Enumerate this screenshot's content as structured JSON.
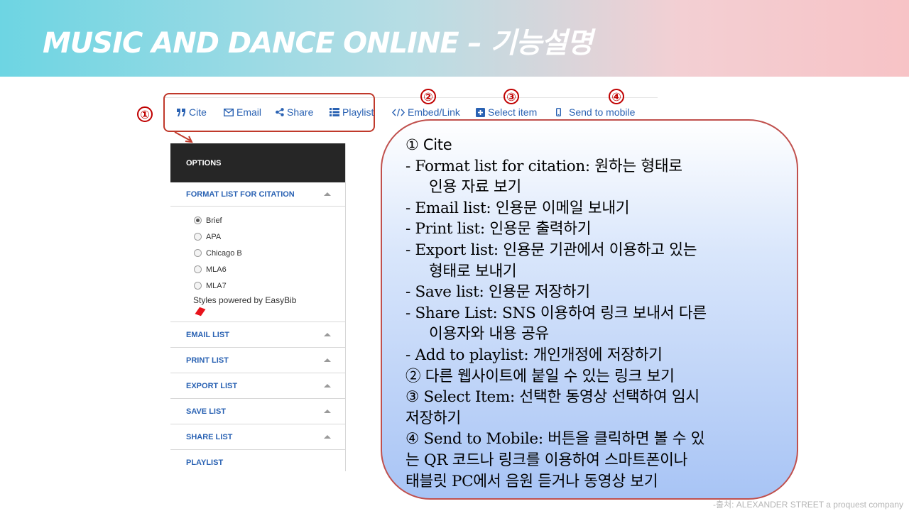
{
  "header": {
    "title": "MUSIC AND DANCE ONLINE – 기능설명"
  },
  "toolbar": {
    "items": [
      {
        "label": "Cite",
        "icon": "quote-icon"
      },
      {
        "label": "Email",
        "icon": "envelope-icon"
      },
      {
        "label": "Share",
        "icon": "share-icon"
      },
      {
        "label": "Playlist",
        "icon": "list-icon"
      },
      {
        "label": "Embed/Link",
        "icon": "code-icon"
      },
      {
        "label": "Select item",
        "icon": "plus-box-icon"
      },
      {
        "label": "Send to mobile",
        "icon": "mobile-icon"
      }
    ]
  },
  "markers": [
    "①",
    "②",
    "③",
    "④"
  ],
  "options": {
    "header": "OPTIONS",
    "format_section": "FORMAT LIST FOR CITATION",
    "radio_options": [
      {
        "label": "Brief",
        "checked": true
      },
      {
        "label": "APA",
        "checked": false
      },
      {
        "label": "Chicago B",
        "checked": false
      },
      {
        "label": "MLA6",
        "checked": false
      },
      {
        "label": "MLA7",
        "checked": false
      }
    ],
    "styles_note": "Styles powered by EasyBib",
    "sections": [
      "EMAIL LIST",
      "PRINT LIST",
      "EXPORT LIST",
      "SAVE LIST",
      "SHARE LIST",
      "PLAYLIST"
    ]
  },
  "description": {
    "lines": [
      {
        "text": "① Cite",
        "style": "lead"
      },
      {
        "text": "- Format list for citation: 원하는 형태로",
        "style": ""
      },
      {
        "text": "인용 자료 보기",
        "style": "ind"
      },
      {
        "text": "- Email list: 인용문 이메일 보내기",
        "style": ""
      },
      {
        "text": "- Print list: 인용문 출력하기",
        "style": ""
      },
      {
        "text": "- Export list: 인용문 기관에서 이용하고 있는",
        "style": ""
      },
      {
        "text": "형태로 보내기",
        "style": "ind"
      },
      {
        "text": "- Save list: 인용문 저장하기",
        "style": ""
      },
      {
        "text": "- Share List: SNS 이용하여 링크 보내서 다른",
        "style": ""
      },
      {
        "text": "이용자와 내용 공유",
        "style": "ind"
      },
      {
        "text": "- Add to playlist: 개인개정에 저장하기",
        "style": ""
      },
      {
        "text": "② 다른 웹사이트에 붙일 수 있는 링크 보기",
        "style": ""
      },
      {
        "text": "③ Select Item: 선택한 동영상 선택하여 임시",
        "style": ""
      },
      {
        "text": "저장하기",
        "style": ""
      },
      {
        "text": "④ Send to Mobile: 버튼을 클릭하면 볼 수 있",
        "style": ""
      },
      {
        "text": "는 QR 코드나 링크를 이용하여 스마트폰이나",
        "style": ""
      },
      {
        "text": "태블릿 PC에서 음원 듣거나 동영상 보기",
        "style": ""
      }
    ]
  },
  "source": "-출처: ALEXANDER STREET a proquest company",
  "colors": {
    "accent_red": "#c00000",
    "link_blue": "#2a62b3",
    "options_header": "#262626"
  }
}
